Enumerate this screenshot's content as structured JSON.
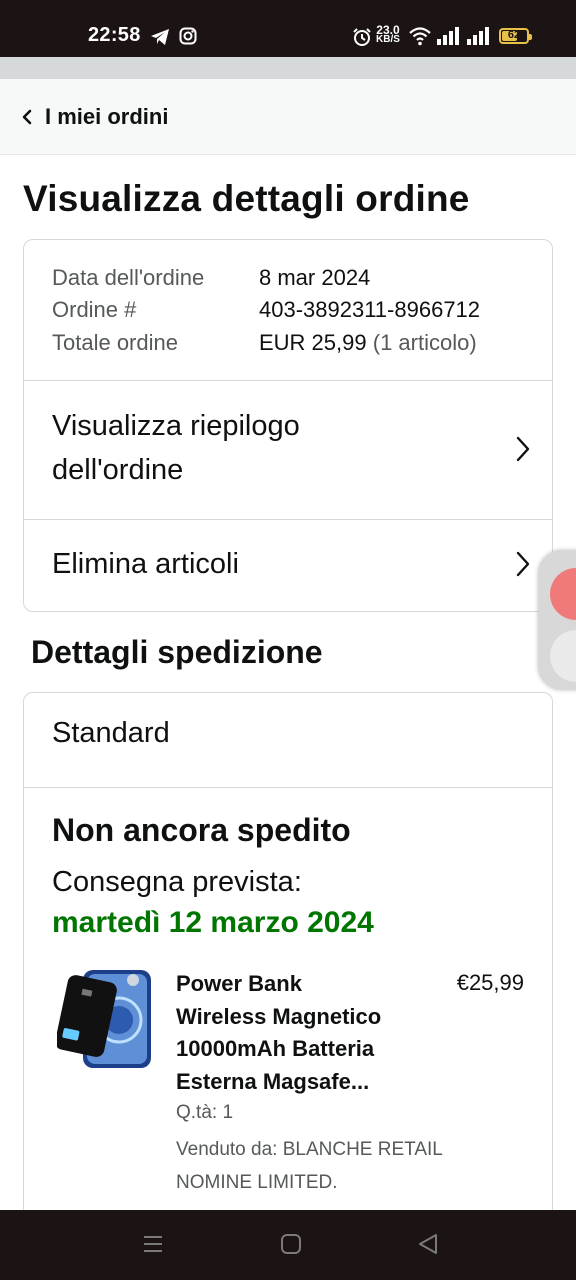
{
  "status_bar": {
    "time": "22:58",
    "net_speed_value": "23.0",
    "net_speed_unit": "KB/S",
    "battery": "62",
    "battery_level_pct": 62,
    "icons": [
      "telegram-icon",
      "instagram-icon",
      "alarm-icon",
      "wifi-icon",
      "signal-icon",
      "signal-icon",
      "battery-icon"
    ]
  },
  "nav": {
    "back_label": "I miei ordini",
    "icon": "chevron-left-icon"
  },
  "page_title": "Visualizza dettagli ordine",
  "order": {
    "date_label": "Data dell'ordine",
    "date_value": "8 mar 2024",
    "number_label": "Ordine #",
    "number_value": "403-3892311-8966712",
    "total_label": "Totale ordine",
    "total_value": "EUR 25,99",
    "total_items": "(1 articolo)"
  },
  "actions": {
    "summary_line1": "Visualizza riepilogo",
    "summary_line2": "dell'ordine",
    "delete_items": "Elimina articoli"
  },
  "shipping": {
    "section_title": "Dettagli spedizione",
    "method": "Standard",
    "status": "Non ancora spedito",
    "delivery_label": "Consegna prevista:",
    "delivery_date": "martedì 12 marzo 2024",
    "accent_color": "#007600"
  },
  "product": {
    "title_line1": "Power Bank",
    "title_line2": "Wireless Magnetico",
    "title_line3": "10000mAh Batteria",
    "title_line4": "Esterna Magsafe...",
    "price": "€25,99",
    "quantity": "Q.tà: 1",
    "seller_line1": "Venduto da: BLANCHE RETAIL",
    "seller_line2": "NOMINE LIMITED."
  },
  "system_nav": {
    "icons": [
      "menu-icon",
      "home-icon",
      "back-icon"
    ]
  }
}
